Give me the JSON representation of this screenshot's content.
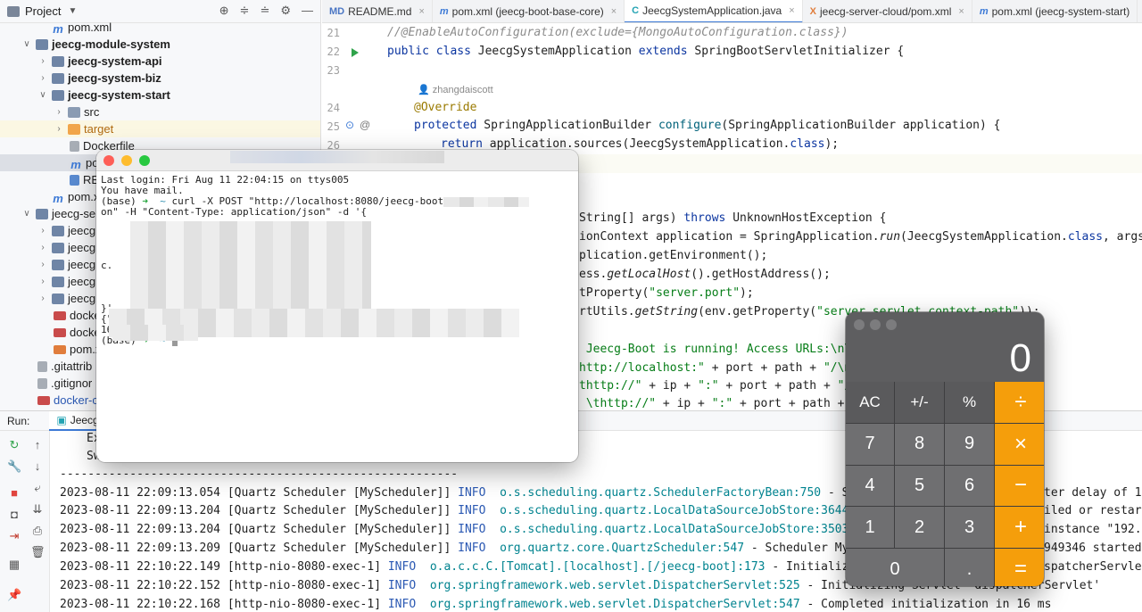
{
  "project_panel": {
    "title": "Project",
    "tree": [
      {
        "label": "pom.xml",
        "icon": "maven-icon"
      },
      {
        "label": "jeecg-module-system",
        "icon": "module-folder-icon",
        "expanded": true
      },
      {
        "label": "jeecg-system-api",
        "icon": "module-folder-icon"
      },
      {
        "label": "jeecg-system-biz",
        "icon": "module-folder-icon"
      },
      {
        "label": "jeecg-system-start",
        "icon": "module-folder-icon",
        "expanded": true
      },
      {
        "label": "src",
        "icon": "folder-icon"
      },
      {
        "label": "target",
        "icon": "folder-orange-icon"
      },
      {
        "label": "Dockerfile",
        "icon": "file-icon"
      },
      {
        "label": "po",
        "icon": "maven-icon"
      },
      {
        "label": "RE",
        "icon": "markdown-icon"
      },
      {
        "label": "pom.x",
        "icon": "maven-icon"
      },
      {
        "label": "jeecg-se",
        "icon": "module-folder-icon"
      },
      {
        "label": "jeecg",
        "icon": "module-folder-icon"
      },
      {
        "label": "jeecg",
        "icon": "module-folder-icon"
      },
      {
        "label": "jeecg",
        "icon": "module-folder-icon"
      },
      {
        "label": "jeecg",
        "icon": "module-folder-icon"
      },
      {
        "label": "jeecg",
        "icon": "module-folder-icon"
      },
      {
        "label": "docke",
        "icon": "yml-icon"
      },
      {
        "label": "docke",
        "icon": "yml-icon"
      },
      {
        "label": "pom.x",
        "icon": "xml-icon"
      },
      {
        "label": ".gitattrib",
        "icon": "file-icon"
      },
      {
        "label": ".gitignor",
        "icon": "file-icon"
      },
      {
        "label": "docker-c",
        "icon": "yml-icon"
      }
    ]
  },
  "editor": {
    "tabs": [
      {
        "label": "README.md",
        "icon": "MD"
      },
      {
        "label": "pom.xml (jeecg-boot-base-core)",
        "icon": "m"
      },
      {
        "label": "JeecgSystemApplication.java",
        "icon": "C",
        "active": true
      },
      {
        "label": "jeecg-server-cloud/pom.xml",
        "icon": "X"
      },
      {
        "label": "pom.xml (jeecg-system-start)",
        "icon": "m"
      }
    ],
    "line_numbers": [
      "21",
      "22",
      "23",
      "24",
      "25",
      "26"
    ],
    "author": "zhangdaiscott",
    "code": {
      "l21": "//@EnableAutoConfiguration(exclude={MongoAutoConfiguration.class})",
      "l22a": "public class ",
      "l22b": "JeecgSystemApplication ",
      "l22c": "extends ",
      "l22d": "SpringBootServletInitializer {",
      "l24": "@Override",
      "l25a": "protected ",
      "l25b": "SpringApplicationBuilder ",
      "l25c": "configure",
      "l25d": "(SpringApplicationBuilder application) {",
      "l26a": "return ",
      "l26b": "application.sources(JeecgSystemApplication.",
      "l26c": "class",
      "l26d": ");",
      "m1a": "String[] args) ",
      "m1b": "throws ",
      "m1c": "UnknownHostException {",
      "m2a": "ionContext application = SpringApplication.",
      "m2b": "run",
      "m2c": "(JeecgSystemApplication.",
      "m2d": "class",
      "m2e": ", args);",
      "m3": "plication.getEnvironment();",
      "m4a": "ess.",
      "m4b": "getLocalHost",
      "m4c": "().getHostAddress();",
      "m5a": "tProperty(",
      "m5b": "\"server.port\"",
      "m5c": ");",
      "m6a": "rtUtils.",
      "m6b": "getString",
      "m6c": "(env.getProperty(",
      "m6d": "\"server.servlet.context-path\"",
      "m6e": "));",
      "m7": " Jeecg-Boot is running! Access URLs:\\n\\t",
      "m8a": "http://localhost:\"",
      "m8b": " + port + path + ",
      "m8c": "\"/\\n\\",
      "m9a": "thttp://\"",
      "m9b": " + ip + ",
      "m9c": "\":\"",
      "m9d": " + port + path + ",
      "m9e": "\"/\\",
      "m10a": " \\thttp://\"",
      "m10b": " + ip + ",
      "m10c": "\":\"",
      "m10d": " + port + path + ",
      "m10e": "\""
    }
  },
  "run_panel": {
    "label": "Run:",
    "tab": "JeecgS",
    "partial": [
      "Ex",
      "Sw"
    ],
    "separator": "---------------------------------------------------------",
    "logs": [
      {
        "ts": "2023-08-11 22:09:13.054",
        "thread": "[Quartz Scheduler [MyScheduler]]",
        "level": "INFO",
        "cls": "o.s.scheduling.quartz.SchedulerFactoryBean:750",
        "msg": " - Start",
        "tail": "ter delay of 1"
      },
      {
        "ts": "2023-08-11 22:09:13.204",
        "thread": "[Quartz Scheduler [MyScheduler]]",
        "level": "INFO",
        "cls": "o.s.scheduling.quartz.LocalDataSourceJobStore:3644",
        "msg": " - C",
        "tail": "iled or restart"
      },
      {
        "ts": "2023-08-11 22:09:13.204",
        "thread": "[Quartz Scheduler [MyScheduler]]",
        "level": "INFO",
        "cls": "o.s.scheduling.quartz.LocalDataSourceJobStore:3503",
        "msg": " - C",
        "tail": "instance \"192.1"
      },
      {
        "ts": "2023-08-11 22:09:13.209",
        "thread": "[Quartz Scheduler [MyScheduler]]",
        "level": "INFO",
        "cls": "org.quartz.core.QuartzScheduler:547",
        "msg": " - Scheduler MySche",
        "tail": "949346 started."
      },
      {
        "ts": "2023-08-11 22:10:22.149",
        "thread": "[http-nio-8080-exec-1]",
        "level": "INFO",
        "cls": "o.a.c.c.C.[Tomcat].[localhost].[/jeecg-boot]:173",
        "msg": " - Initializing",
        "tail": "spatcherServlet"
      },
      {
        "ts": "2023-08-11 22:10:22.152",
        "thread": "[http-nio-8080-exec-1]",
        "level": "INFO",
        "cls": "org.springframework.web.servlet.DispatcherServlet:525",
        "msg": " - Initializing Servlet 'dispatcherServlet'",
        "tail": ""
      },
      {
        "ts": "2023-08-11 22:10:22.168",
        "thread": "[http-nio-8080-exec-1]",
        "level": "INFO",
        "cls": "org.springframework.web.servlet.DispatcherServlet:547",
        "msg": " - Completed initialization in 16 ms",
        "tail": ""
      }
    ]
  },
  "terminal": {
    "line1": "Last login: Fri Aug 11 22:04:15 on ttys005",
    "line2": "You have mail.",
    "prompt_env": "(base)",
    "prompt_arrow": "➜",
    "prompt_dir": "~",
    "command": "curl -X POST \"http://localhost:8080/jeecg-boot",
    "line4": "on\" -H \"Content-Type: application/json\" -d '{",
    "frag_c": "c.",
    "frag_close": "}'",
    "frag_brace": "{\"",
    "frag_16": "16"
  },
  "calculator": {
    "display": "0",
    "keys": [
      "AC",
      "+/-",
      "%",
      "÷",
      "7",
      "8",
      "9",
      "×",
      "4",
      "5",
      "6",
      "−",
      "1",
      "2",
      "3",
      "+",
      "0",
      ".",
      "="
    ],
    "accent_color": "#f59e0b"
  }
}
